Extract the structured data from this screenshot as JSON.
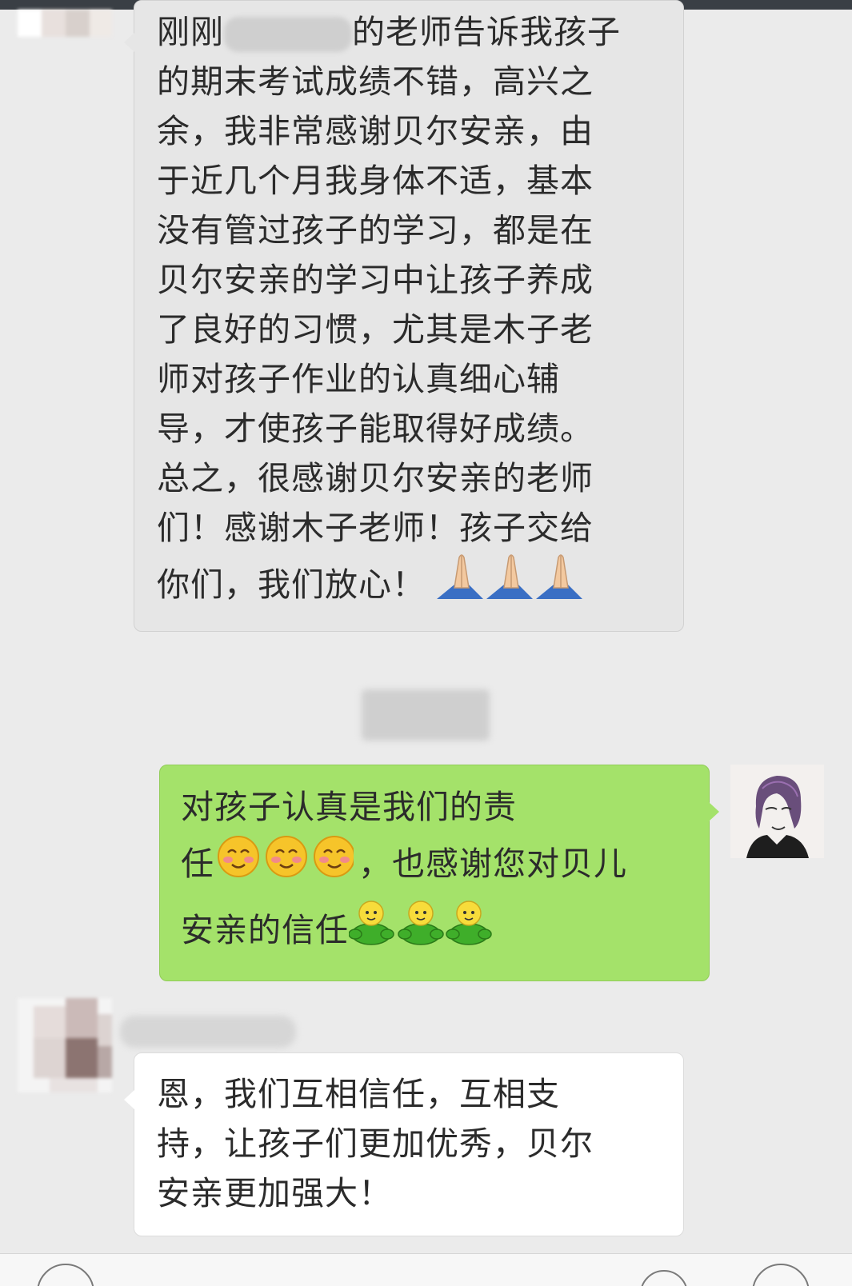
{
  "messages": [
    {
      "direction": "incoming",
      "lines": [
        "刚刚",
        "的期末考试成绩不错，高兴之",
        "余，我非常感谢贝尔安亲，由",
        "于近几个月我身体不适，基本",
        "没有管过孩子的学习，都是在",
        "贝尔安亲的学习中让孩子养成",
        "了良好的习惯，尤其是木子老",
        "师对孩子作业的认真细心辅",
        "导，才使孩子能取得好成绩。",
        "总之，很感谢贝尔安亲的老师",
        "们！感谢木子老师！孩子交给",
        "你们，我们放心！"
      ],
      "line1_tail": "的老师告诉我孩子",
      "emojis": [
        "folded-hands",
        "folded-hands",
        "folded-hands"
      ]
    },
    {
      "direction": "outgoing",
      "lines": [
        "对孩子认真是我们的责",
        "任",
        "，也感谢您对贝儿",
        "安亲的信任"
      ],
      "emojis_line2": [
        "blush",
        "blush",
        "blush"
      ],
      "emojis_line3": [
        "green-figure",
        "green-figure",
        "green-figure"
      ]
    },
    {
      "direction": "incoming",
      "lines": [
        "恩，我们互相信任，互相支",
        "持，让孩子们更加优秀，贝尔",
        "安亲更加强大！"
      ]
    }
  ],
  "colors": {
    "background": "#ebebeb",
    "incoming_bubble": "#e6e6e6",
    "outgoing_bubble": "#a4e26a",
    "text": "#2b2b2b"
  }
}
